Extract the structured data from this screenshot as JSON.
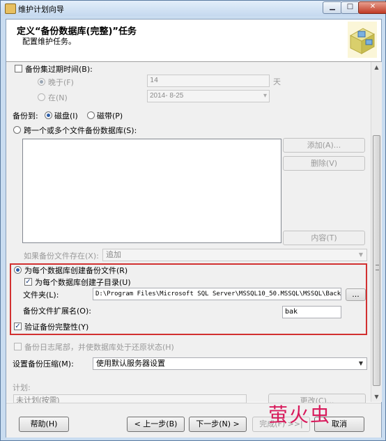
{
  "window": {
    "title": "维护计划向导",
    "min_glyph": "▁",
    "max_glyph": "□",
    "close_glyph": "✕"
  },
  "header": {
    "title": "定义“备份数据库(完整)”任务",
    "subtitle": "配置维护任务。"
  },
  "expire": {
    "checkbox_label": "备份集过期时间(B):",
    "after_label": "晚于(F)",
    "after_value": "14",
    "after_unit": "天",
    "on_label": "在(N)",
    "on_value": "2014- 8-25"
  },
  "backup_to": {
    "label": "备份到:",
    "disk": "磁盘(I)",
    "tape": "磁带(P)"
  },
  "multi_files": {
    "radio_label": "跨一个或多个文件备份数据库(S):",
    "add_button": "添加(A)...",
    "remove_button": "删除(V)",
    "contents_button": "内容(T)",
    "exists_label": "如果备份文件存在(X):",
    "exists_value": "追加"
  },
  "per_db": {
    "radio_label": "为每个数据库创建备份文件(R)",
    "subdir_label": "为每个数据库创建子目录(U)",
    "folder_label": "文件夹(L):",
    "folder_value": "D:\\Program Files\\Microsoft SQL Server\\MSSQL10_50.MSSQL\\MSSQL\\Backup",
    "browse_button": "...",
    "ext_label": "备份文件扩展名(O):",
    "ext_value": "bak"
  },
  "verify_label": "验证备份完整性(Y)",
  "tail_log_label": "备份日志尾部，并使数据库处于还原状态(H)",
  "compression": {
    "label": "设置备份压缩(M):",
    "value": "使用默认服务器设置"
  },
  "schedule": {
    "label": "计划:",
    "value": "未计划(按需)",
    "change_button": "更改(C)..."
  },
  "footer": {
    "help": "帮助(H)",
    "back": "< 上一步(B)",
    "next": "下一步(N) >",
    "finish": "完成(F) >>|",
    "cancel": "取消",
    "watermark": "萤火虫"
  },
  "colors": {
    "highlight_box": "#d23030",
    "watermark": "#d81b5c",
    "accent": "#2c5ea8"
  }
}
